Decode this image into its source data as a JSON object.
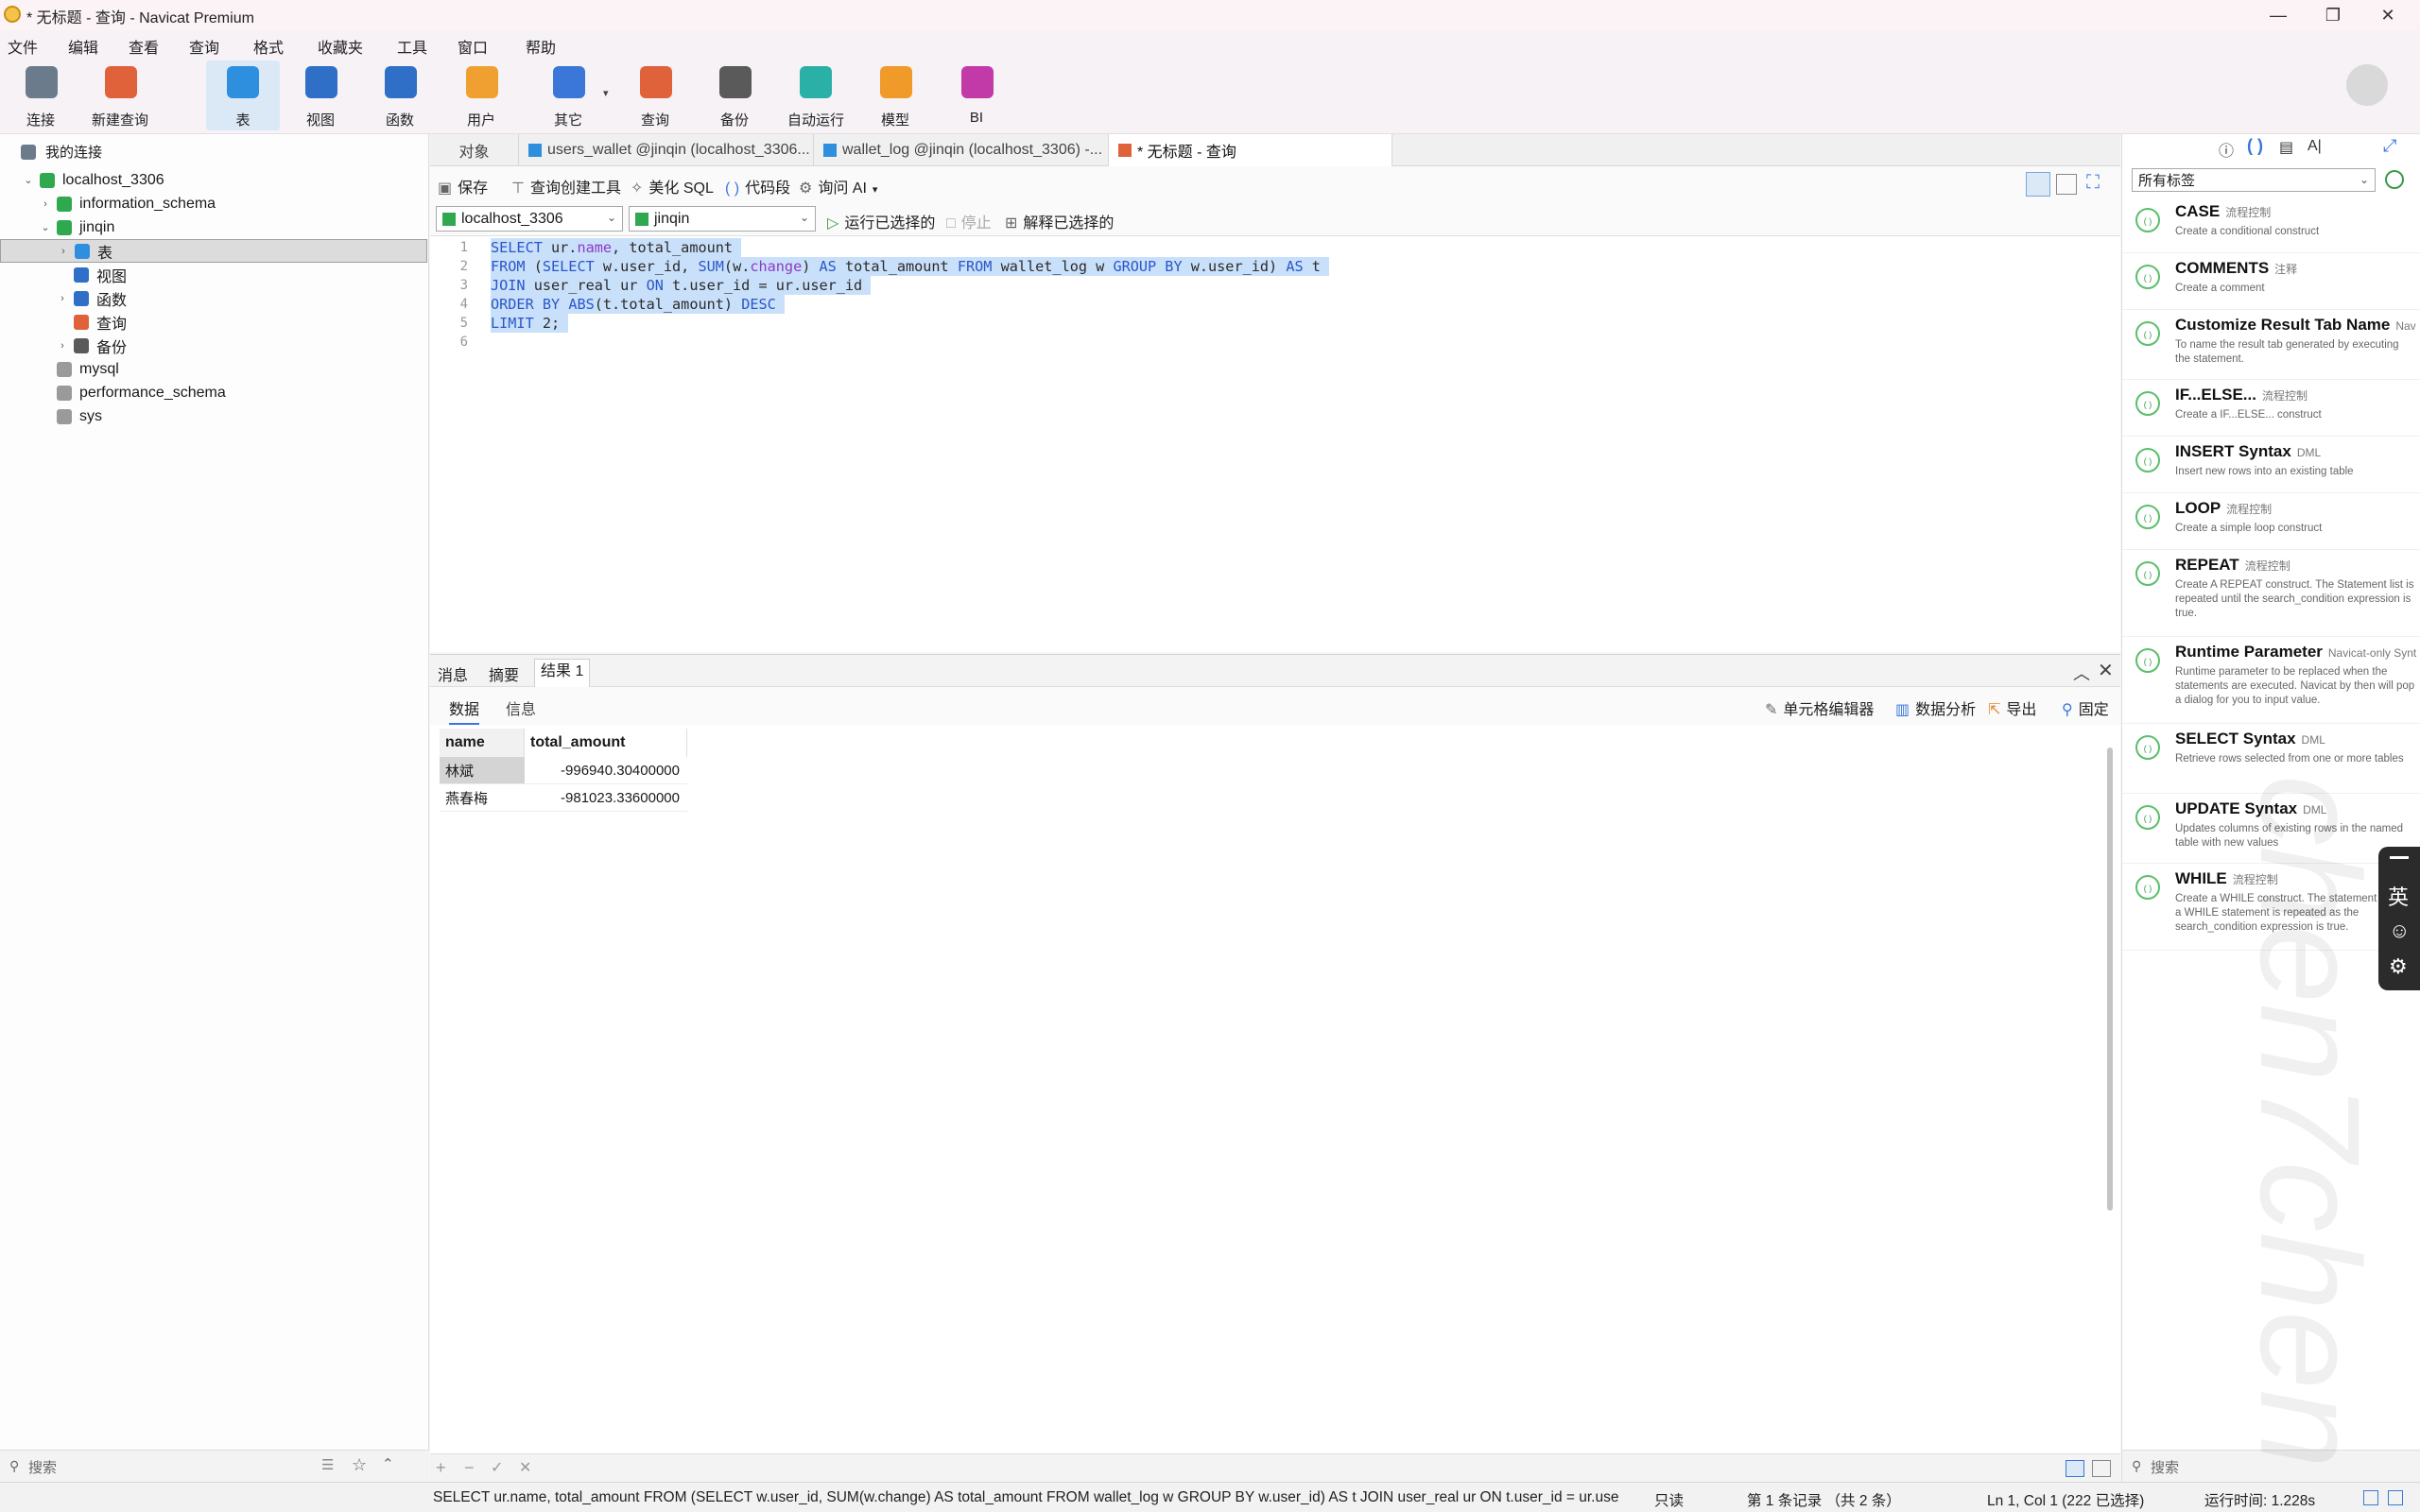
{
  "window": {
    "title": "* 无标题 - 查询 - Navicat Premium",
    "min": "—",
    "max": "❐",
    "close": "✕"
  },
  "menu": [
    "文件",
    "编辑",
    "查看",
    "查询",
    "格式",
    "收藏夹",
    "工具",
    "窗口",
    "帮助"
  ],
  "toolbar": [
    {
      "label": "连接",
      "icon": "connection-icon",
      "color": "#6b7b8c"
    },
    {
      "label": "新建查询",
      "icon": "new-query-icon",
      "color": "#e0623a"
    },
    {
      "label": "表",
      "icon": "table-icon",
      "color": "#2f8fdf"
    },
    {
      "label": "视图",
      "icon": "view-icon",
      "color": "#2f6fc7"
    },
    {
      "label": "函数",
      "icon": "function-icon",
      "color": "#2f6fc7"
    },
    {
      "label": "用户",
      "icon": "user-icon",
      "color": "#f0a030"
    },
    {
      "label": "其它",
      "icon": "tools-icon",
      "color": "#3a77d8"
    },
    {
      "label": "查询",
      "icon": "query-icon",
      "color": "#e0623a"
    },
    {
      "label": "备份",
      "icon": "backup-icon",
      "color": "#5a5a5a"
    },
    {
      "label": "自动运行",
      "icon": "robot-icon",
      "color": "#2bb0a8"
    },
    {
      "label": "模型",
      "icon": "model-icon",
      "color": "#f09a2a"
    },
    {
      "label": "BI",
      "icon": "bi-icon",
      "color": "#c23aa8"
    }
  ],
  "nav": {
    "root": "我的连接",
    "items": [
      {
        "label": "localhost_3306",
        "level": 0,
        "arrow": "⌄",
        "color": "#2fa84f"
      },
      {
        "label": "information_schema",
        "level": 1,
        "arrow": "›",
        "color": "#2fa84f"
      },
      {
        "label": "jinqin",
        "level": 1,
        "arrow": "⌄",
        "color": "#2fa84f"
      },
      {
        "label": "表",
        "level": 2,
        "arrow": "›",
        "color": "#2f8fdf",
        "selected": true
      },
      {
        "label": "视图",
        "level": 2,
        "arrow": "",
        "color": "#2f6fc7"
      },
      {
        "label": "函数",
        "level": 2,
        "arrow": "›",
        "color": "#2f6fc7"
      },
      {
        "label": "查询",
        "level": 2,
        "arrow": "",
        "color": "#e0623a"
      },
      {
        "label": "备份",
        "level": 2,
        "arrow": "›",
        "color": "#5a5a5a"
      },
      {
        "label": "mysql",
        "level": 1,
        "arrow": "",
        "color": "#9a9a9a"
      },
      {
        "label": "performance_schema",
        "level": 1,
        "arrow": "",
        "color": "#9a9a9a"
      },
      {
        "label": "sys",
        "level": 1,
        "arrow": "",
        "color": "#9a9a9a"
      }
    ],
    "search_placeholder": "搜索"
  },
  "tabs": [
    {
      "label": "对象"
    },
    {
      "label": "users_wallet @jinqin (localhost_3306..."
    },
    {
      "label": "wallet_log @jinqin (localhost_3306) -..."
    },
    {
      "label": "* 无标题 - 查询",
      "active": true
    }
  ],
  "query_toolbar": {
    "save": "保存",
    "builder": "查询创建工具",
    "beautify": "美化 SQL",
    "snippet": "代码段",
    "ask_ai": "询问 AI",
    "run_selected": "运行已选择的",
    "stop": "停止",
    "explain": "解释已选择的"
  },
  "selectors": {
    "connection": "localhost_3306",
    "database": "jinqin"
  },
  "editor": {
    "line_numbers": [
      "1",
      "2",
      "3",
      "4",
      "5",
      "6"
    ]
  },
  "results": {
    "tabs": [
      "消息",
      "摘要",
      "结果 1"
    ],
    "subtabs": [
      "数据",
      "信息"
    ],
    "actions": {
      "cell_editor": "单元格编辑器",
      "data_analysis": "数据分析",
      "export": "导出",
      "pin": "固定"
    },
    "columns": [
      "name",
      "total_amount"
    ],
    "rows": [
      [
        "林斌",
        "-996940.30400000"
      ],
      [
        "燕春梅",
        "-981023.33600000"
      ]
    ]
  },
  "right_panel": {
    "tag_filter": "所有标签",
    "snippets": [
      {
        "title": "CASE",
        "tag": "流程控制",
        "desc": "Create a conditional construct"
      },
      {
        "title": "COMMENTS",
        "tag": "注释",
        "desc": "Create a comment"
      },
      {
        "title": "Customize Result Tab Name",
        "tag": "Nav",
        "desc": "To name the result tab generated by executing the statement."
      },
      {
        "title": "IF...ELSE...",
        "tag": "流程控制",
        "desc": "Create a IF...ELSE... construct"
      },
      {
        "title": "INSERT Syntax",
        "tag": "DML",
        "desc": "Insert new rows into an existing table"
      },
      {
        "title": "LOOP",
        "tag": "流程控制",
        "desc": "Create a simple loop construct"
      },
      {
        "title": "REPEAT",
        "tag": "流程控制",
        "desc": "Create A REPEAT construct. The Statement list is repeated until the search_condition expression is true."
      },
      {
        "title": "Runtime Parameter",
        "tag": "Navicat-only Synt",
        "desc": "Runtime parameter to be replaced when the statements are executed. Navicat by then will pop a dialog for you to input value."
      },
      {
        "title": "SELECT Syntax",
        "tag": "DML",
        "desc": "Retrieve rows selected from one or more tables"
      },
      {
        "title": "UPDATE Syntax",
        "tag": "DML",
        "desc": "Updates columns of existing rows in the named table with new values"
      },
      {
        "title": "WHILE",
        "tag": "流程控制",
        "desc": "Create a WHILE construct. The statement within a WHILE statement is repeated as the search_condition expression is true."
      }
    ],
    "search_placeholder": "搜索"
  },
  "status": {
    "sql": "SELECT ur.name, total_amount FROM (SELECT w.user_id, SUM(w.change) AS total_amount FROM wallet_log w GROUP BY w.user_id) AS t JOIN user_real ur ON t.user_id = ur.use",
    "readonly": "只读",
    "records": "第 1 条记录 （共 2 条）",
    "cursor": "Ln 1, Col 1 (222 已选择)",
    "runtime": "运行时间: 1.228s"
  },
  "ime": {
    "lang": "英"
  },
  "watermark": "chen7chen"
}
